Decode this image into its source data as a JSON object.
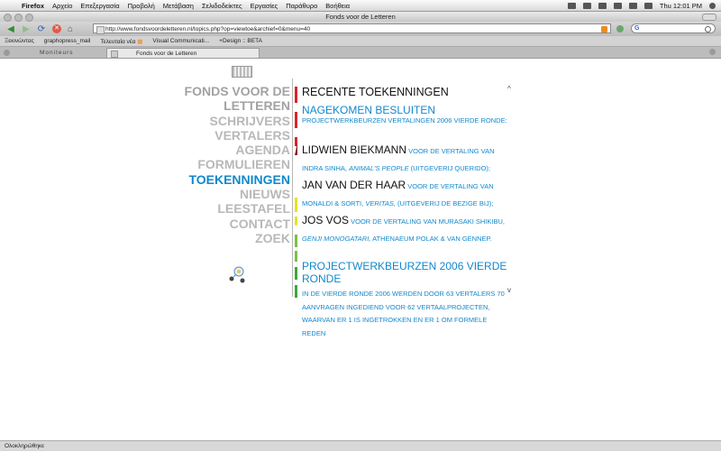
{
  "menubar": {
    "app": "Firefox",
    "items": [
      "Αρχείο",
      "Επεξεργασία",
      "Προβολή",
      "Μετάβαση",
      "Σελιδοδείκτες",
      "Εργασίες",
      "Παράθυρο",
      "Βοήθεια"
    ],
    "clock": "Thu 12:01 PM"
  },
  "window": {
    "title": "Fonds voor de Letteren"
  },
  "toolbar": {
    "url": "http://www.fondsvoordeletteren.nl/topics.php?op=viewtoe&archief=0&menu=40",
    "search_engine": "G"
  },
  "bookmarks": [
    "Ξεκινώντας",
    "graphopress_mail",
    "Τελευταία νέα",
    "Visual Communicati...",
    "+Design :: BETA"
  ],
  "tabs": [
    {
      "label": "Moniteurs",
      "active": false
    },
    {
      "label": "Fonds voor de Letteren",
      "active": true
    }
  ],
  "site": {
    "nav": {
      "brand": "FONDS VOOR DE LETTEREN",
      "items": [
        "SCHRIJVERS",
        "VERTALERS",
        "AGENDA",
        "FORMULIEREN",
        "TOEKENNINGEN",
        "NIEUWS",
        "LEESTAFEL",
        "CONTACT",
        "ZOEK"
      ],
      "active": "TOEKENNINGEN"
    },
    "content": {
      "heading": "RECENTE TOEKENNINGEN",
      "section1_title": "NAGEKOMEN BESLUITEN",
      "section1_subtitle": "PROJECTWERKBEURZEN VERTALINGEN 2006 VIERDE RONDE:",
      "award1": {
        "name": "LIDWIEN BIEKMANN",
        "pre": "VOOR DE VERTALING VAN INDRA SINHA,",
        "title": "ANIMAL'S PEOPLE",
        "post": "(UITGEVERIJ QUERIDO);"
      },
      "award2": {
        "name": "JAN VAN DER HAAR",
        "pre": "VOOR DE VERTALING VAN MONALDI & SORTI,",
        "title": "VERITAS,",
        "post": "(UITGEVERIJ DE BEZIGE BIJ);"
      },
      "award3": {
        "name": "JOS VOS",
        "pre": "VOOR DE VERTALING VAN MURASAKI SHIKIBU,",
        "title": "GENJI MONOGATARI,",
        "post": "ATHENAEUM POLAK & VAN GENNEP."
      },
      "section2_title": "PROJECTWERKBEURZEN 2006 VIERDE RONDE",
      "section2_body": "IN DE VIERDE RONDE 2006 WERDEN DOOR 63 VERTALERS 70 AANVRAGEN INGEDIEND VOOR 62 VERTAALPROJECTEN, WAARVAN ER 1 IS INGETROKKEN EN ER 1 OM FORMELE REDEN",
      "scroll_up": "^",
      "scroll_down": "v"
    },
    "accent_bars": [
      "#d8242c",
      "#d8242c",
      "#d8242c",
      "#8b1b20",
      "#e8e21c",
      "#e8e21c",
      "#7ac143",
      "#7ac143",
      "#3aa935",
      "#3aa935"
    ]
  },
  "statusbar": {
    "text": "Ολοκληρώθηκε"
  }
}
